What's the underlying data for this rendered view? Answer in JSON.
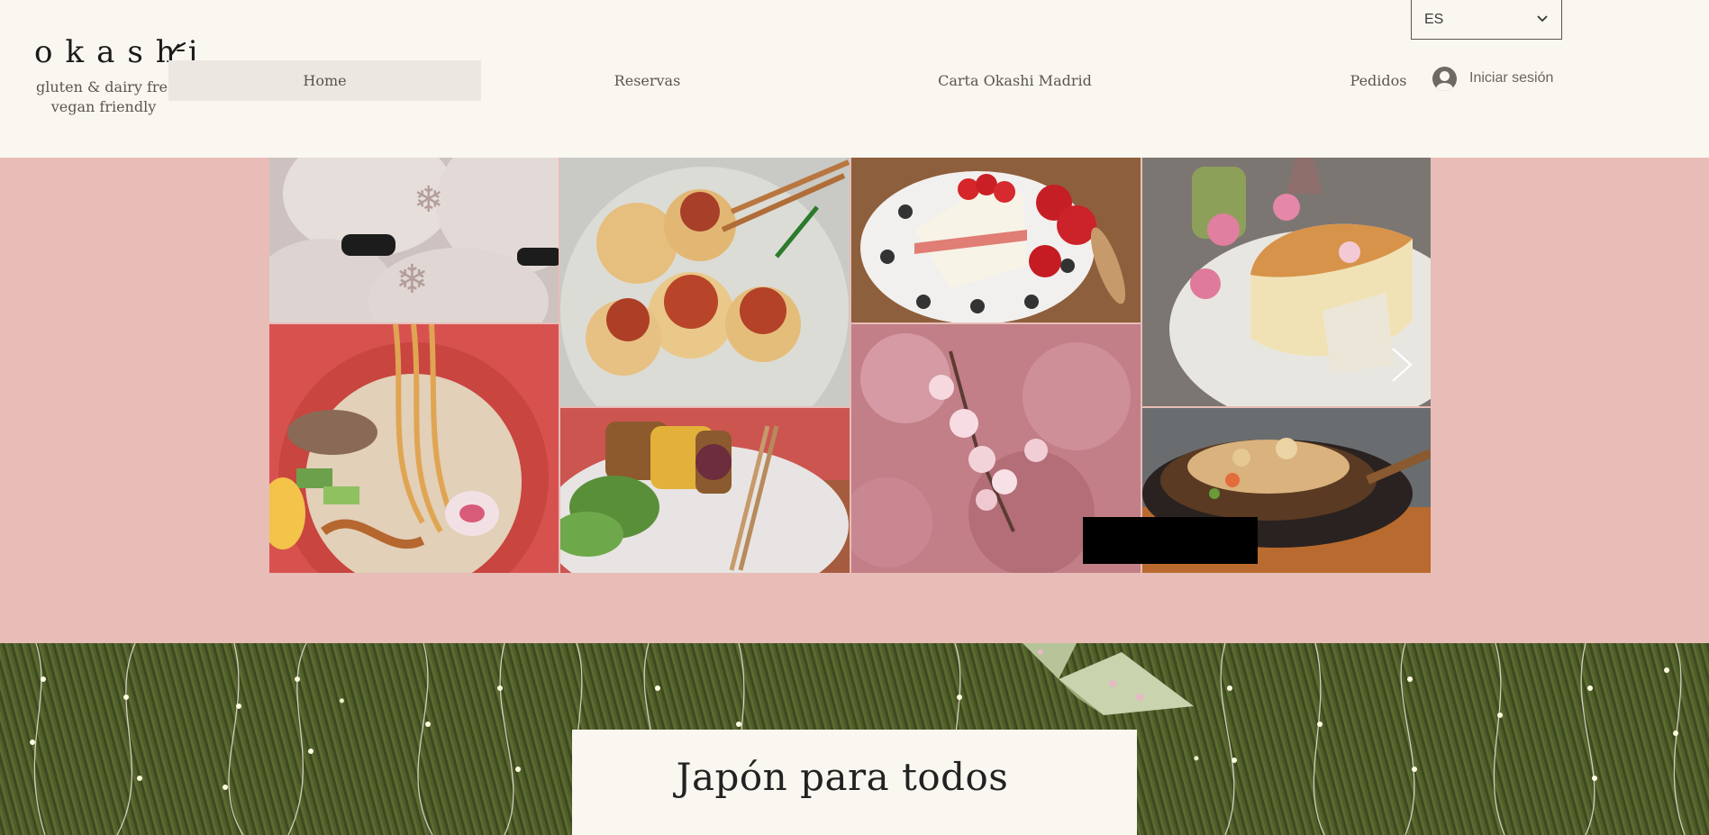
{
  "header": {
    "logo_text": "okashi",
    "tagline_line1": "gluten & dairy free",
    "tagline_line2": "vegan friendly",
    "nav": {
      "home": "Home",
      "reservas": "Reservas",
      "carta": "Carta Okashi Madrid",
      "pedidos": "Pedidos"
    },
    "language": "ES",
    "login_label": "Iniciar sesión"
  },
  "gallery": {
    "tiles": [
      {
        "name": "paper-lanterns-photo",
        "color": "#d9cfcc"
      },
      {
        "name": "ramen-photo",
        "color": "#c96a55"
      },
      {
        "name": "takoyaki-photo",
        "color": "#d7d0c0"
      },
      {
        "name": "croquettes-salad-photo",
        "color": "#b9785c"
      },
      {
        "name": "strawberry-cake-photo",
        "color": "#9a6b4a"
      },
      {
        "name": "cherry-blossom-photo",
        "color": "#c97f86"
      },
      {
        "name": "cheesecake-photo",
        "color": "#d7a16b"
      },
      {
        "name": "okonomiyaki-photo",
        "color": "#8a5a34"
      }
    ]
  },
  "section": {
    "title": "Japón para todos"
  },
  "colors": {
    "background": "#faf7f0",
    "pink_band": "#e8bdb8",
    "nav_active": "#ece8e1"
  }
}
